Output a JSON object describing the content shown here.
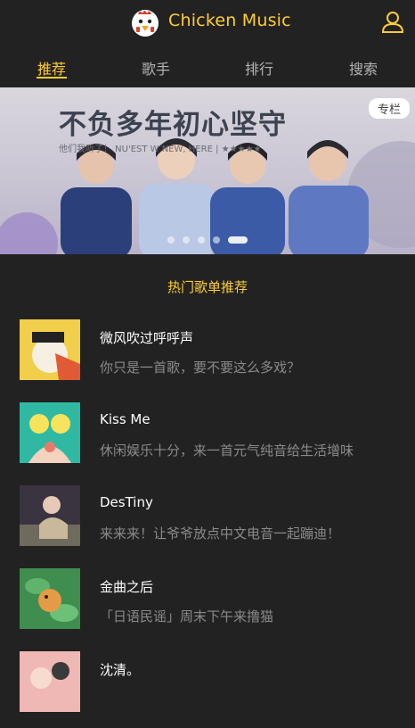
{
  "header": {
    "title": "Chicken Music",
    "logo": "chicken-logo-icon",
    "user_icon": "user-icon"
  },
  "tabs": [
    {
      "label": "推荐",
      "active": true
    },
    {
      "label": "歌手",
      "active": false
    },
    {
      "label": "排行",
      "active": false
    },
    {
      "label": "搜索",
      "active": false
    }
  ],
  "banner": {
    "tag": "专栏",
    "headline": "不负多年初心坚守",
    "subtext": "他们我听了！ NU'EST W NEW, HERE | ★★★★★",
    "slide_count": 5,
    "active_slide": 5
  },
  "section_title": "热门歌单推荐",
  "playlists": [
    {
      "name": "微风吹过呼呼声",
      "desc": "你只是一首歌，要不要这么多戏？"
    },
    {
      "name": "Kiss Me",
      "desc": "休闲娱乐十分，来一首元气纯音给生活增味"
    },
    {
      "name": "DesTiny",
      "desc": "来来来！让爷爷放点中文电音一起蹦迪！"
    },
    {
      "name": "金曲之后",
      "desc": "「日语民谣」周末下午来撸猫"
    },
    {
      "name": "沈清。",
      "desc": ""
    }
  ],
  "colors": {
    "accent": "#ffcd32",
    "background": "#222222",
    "muted": "#8a8a8a"
  }
}
